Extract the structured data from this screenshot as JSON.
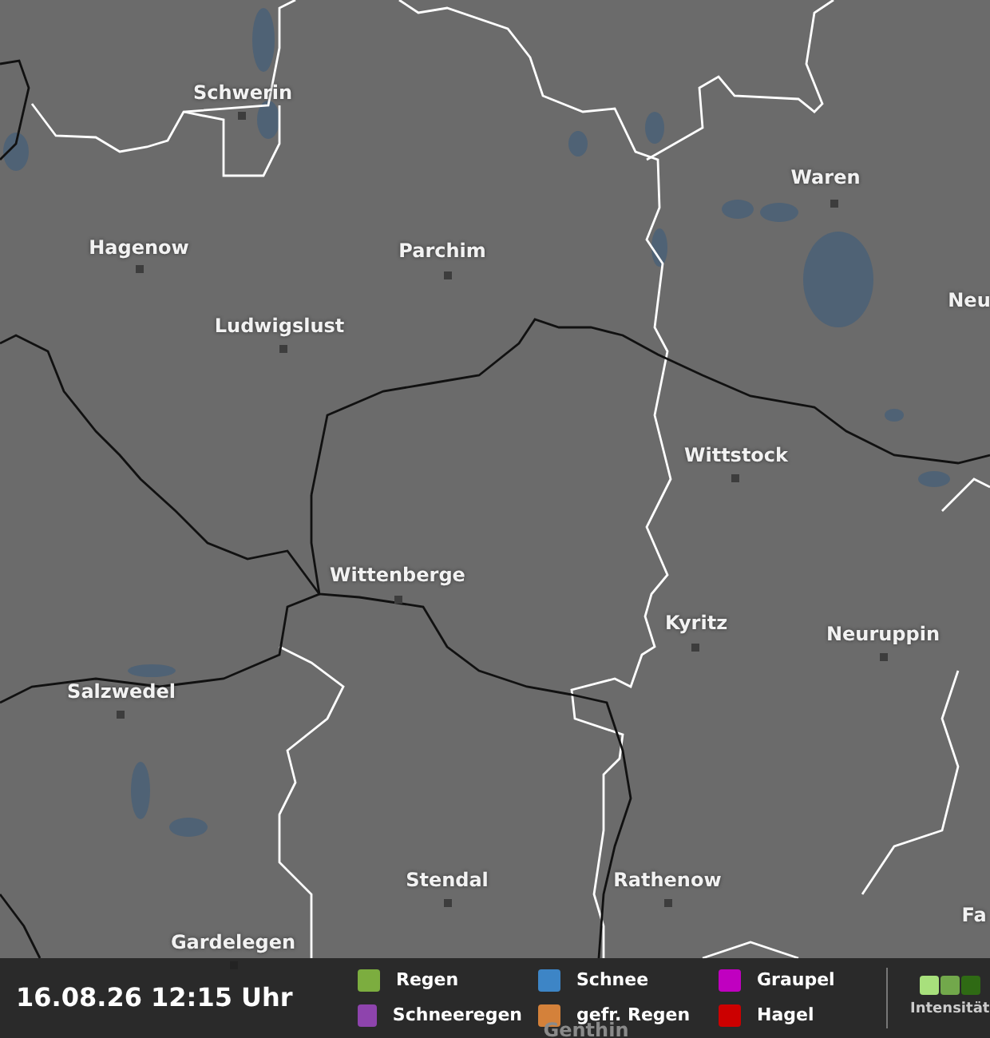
{
  "map": {
    "cities": [
      {
        "name": "Schwerin"
      },
      {
        "name": "Waren"
      },
      {
        "name": "Hagenow"
      },
      {
        "name": "Parchim"
      },
      {
        "name": "Neu"
      },
      {
        "name": "Ludwigslust"
      },
      {
        "name": "Wittstock"
      },
      {
        "name": "Wittenberge"
      },
      {
        "name": "Kyritz"
      },
      {
        "name": "Neuruppin"
      },
      {
        "name": "Salzwedel"
      },
      {
        "name": "Stendal"
      },
      {
        "name": "Rathenow"
      },
      {
        "name": "Fa"
      },
      {
        "name": "Gardelegen"
      },
      {
        "name": "Genthin"
      }
    ]
  },
  "footer": {
    "timestamp": "16.08.26 12:15 Uhr",
    "legend": [
      {
        "label": "Regen",
        "color": "#7cad3f"
      },
      {
        "label": "Schneeregen",
        "color": "#8e44ad"
      },
      {
        "label": "Schnee",
        "color": "#3d85c6"
      },
      {
        "label": "gefr. Regen",
        "color": "#d4813a"
      },
      {
        "label": "Graupel",
        "color": "#c000c0"
      },
      {
        "label": "Hagel",
        "color": "#cc0000"
      }
    ],
    "intensity": {
      "label": "Intensität",
      "steps": [
        {
          "color": "#a8e07c"
        },
        {
          "color": "#72a84b"
        },
        {
          "color": "#2f6a14"
        }
      ]
    }
  }
}
